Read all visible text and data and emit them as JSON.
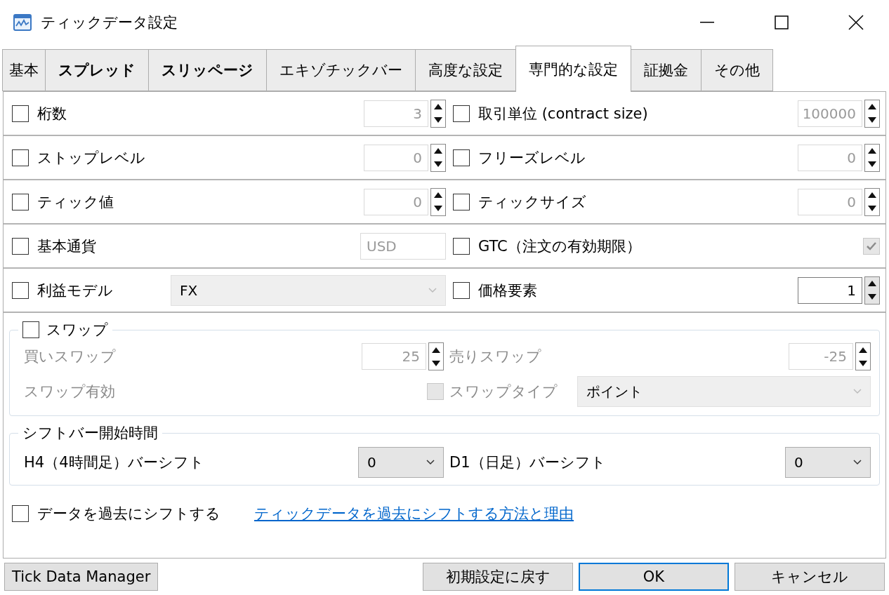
{
  "window": {
    "title": "ティックデータ設定"
  },
  "tabs": [
    {
      "label": "基本",
      "selected": false,
      "bold": false
    },
    {
      "label": "スプレッド",
      "selected": false,
      "bold": true
    },
    {
      "label": "スリッページ",
      "selected": false,
      "bold": true
    },
    {
      "label": "エキゾチックバー",
      "selected": false,
      "bold": false
    },
    {
      "label": "高度な設定",
      "selected": false,
      "bold": false
    },
    {
      "label": "専門的な設定",
      "selected": true,
      "bold": false
    },
    {
      "label": "証拠金",
      "selected": false,
      "bold": false
    },
    {
      "label": "その他",
      "selected": false,
      "bold": false
    }
  ],
  "rows": [
    {
      "left": {
        "label": "桁数",
        "checked": false,
        "control": {
          "kind": "spin",
          "value": "3",
          "disabled": true
        }
      },
      "right": {
        "label": "取引単位 (contract size)",
        "checked": false,
        "control": {
          "kind": "spin",
          "value": "100000",
          "disabled": true
        }
      }
    },
    {
      "left": {
        "label": "ストップレベル",
        "checked": false,
        "control": {
          "kind": "spin",
          "value": "0",
          "disabled": true
        }
      },
      "right": {
        "label": "フリーズレベル",
        "checked": false,
        "control": {
          "kind": "spin",
          "value": "0",
          "disabled": true
        }
      }
    },
    {
      "left": {
        "label": "ティック値",
        "checked": false,
        "control": {
          "kind": "spin",
          "value": "0",
          "disabled": true
        }
      },
      "right": {
        "label": "ティックサイズ",
        "checked": false,
        "control": {
          "kind": "spin",
          "value": "0",
          "disabled": true
        }
      }
    },
    {
      "left": {
        "label": "基本通貨",
        "checked": false,
        "control": {
          "kind": "text",
          "value": "USD",
          "disabled": true
        }
      },
      "right": {
        "label": "GTC（注文の有効期限）",
        "checked": false,
        "control": {
          "kind": "check",
          "checked": true,
          "disabled": true
        }
      }
    },
    {
      "left": {
        "label": "利益モデル",
        "checked": false,
        "control": {
          "kind": "select",
          "value": "FX",
          "disabled": true
        }
      },
      "right": {
        "label": "価格要素",
        "checked": false,
        "control": {
          "kind": "spin",
          "value": "1",
          "disabled": false
        }
      }
    }
  ],
  "swap": {
    "label": "スワップ",
    "checked": false,
    "items": [
      {
        "label": "買いスワップ",
        "disabled": true,
        "control": {
          "kind": "spin",
          "value": "25",
          "disabled": true
        }
      },
      {
        "label": "売りスワップ",
        "disabled": true,
        "control": {
          "kind": "spin",
          "value": "-25",
          "disabled": true
        }
      },
      {
        "label": "スワップ有効",
        "disabled": true,
        "control": {
          "kind": "check",
          "checked": false,
          "disabled": true
        }
      },
      {
        "label": "スワップタイプ",
        "disabled": true,
        "control": {
          "kind": "select",
          "value": "ポイント",
          "disabled": true
        }
      }
    ]
  },
  "shift": {
    "title": "シフトバー開始時間",
    "items": [
      {
        "label": "H4（4時間足）バーシフト",
        "disabled": false,
        "control": {
          "kind": "select",
          "value": "0",
          "disabled": false
        }
      },
      {
        "label": "D1（日足）バーシフト",
        "disabled": false,
        "control": {
          "kind": "select",
          "value": "0",
          "disabled": false
        }
      }
    ]
  },
  "shift_data": {
    "label": "データを過去にシフトする",
    "checked": false,
    "link": "ティックデータを過去にシフトする方法と理由"
  },
  "buttons": [
    {
      "label": "Tick Data Manager",
      "focused": false
    },
    {
      "label": "初期設定に戻す",
      "focused": false
    },
    {
      "label": "OK",
      "focused": true
    },
    {
      "label": "キャンセル",
      "focused": false
    }
  ]
}
